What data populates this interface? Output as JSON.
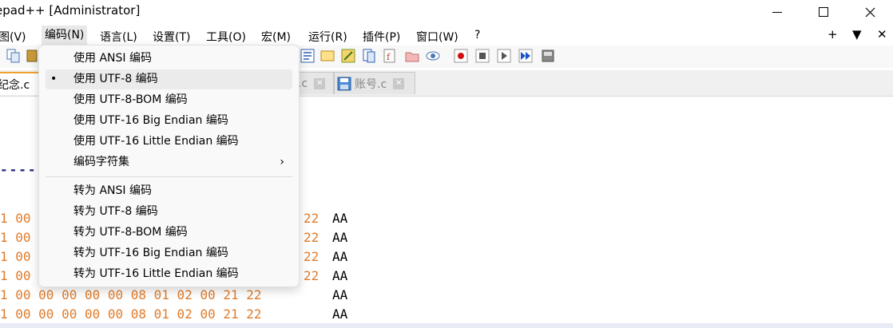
{
  "window": {
    "title": "epad++ [Administrator]",
    "minimize_icon": "minimize-icon",
    "maximize_icon": "maximize-icon",
    "close_icon": "close-icon"
  },
  "menubar": {
    "items": [
      "图(V)",
      "编码(N)",
      "语言(L)",
      "设置(T)",
      "工具(O)",
      "宏(M)",
      "运行(R)",
      "插件(P)",
      "窗口(W)",
      "?"
    ],
    "right": [
      "+",
      "▼",
      "✕"
    ]
  },
  "tabs": [
    {
      "label": "纪念.c"
    },
    {
      "label": ".c"
    },
    {
      "label": "账号.c"
    }
  ],
  "encoding_menu": {
    "items": [
      {
        "label": "使用 ANSI 编码",
        "selected": false
      },
      {
        "label": "使用 UTF-8 编码",
        "selected": true
      },
      {
        "label": "使用 UTF-8-BOM 编码",
        "selected": false
      },
      {
        "label": "使用 UTF-16 Big Endian 编码",
        "selected": false
      },
      {
        "label": "使用 UTF-16 Little Endian 编码",
        "selected": false
      },
      {
        "label": "编码字符集",
        "submenu": true
      }
    ],
    "convert_items": [
      {
        "label": "转为 ANSI 编码"
      },
      {
        "label": "转为 UTF-8 编码"
      },
      {
        "label": "转为 UTF-8-BOM 编码"
      },
      {
        "label": "转为 UTF-16 Big Endian 编码"
      },
      {
        "label": "转为 UTF-16 Little Endian 编码"
      }
    ],
    "bullet": "•",
    "submenu_arrow": "›"
  },
  "editor": {
    "dashes": "----",
    "lines": [
      {
        "hex": "1 00",
        "tail": "22",
        "aa": "AA"
      },
      {
        "hex": "1 00",
        "tail": "22",
        "aa": "AA"
      },
      {
        "hex": "1 00",
        "tail": "22",
        "aa": "AA"
      },
      {
        "hex": "1 00",
        "tail": "22",
        "aa": "AA"
      },
      {
        "hex": "1 00 00 00 00 00 08 01 02 00 21 22",
        "tail": "",
        "aa": "AA"
      },
      {
        "hex": "1 00 00 00 00 00 08 01 02 00 21 22",
        "tail": "",
        "aa": "AA"
      }
    ]
  }
}
